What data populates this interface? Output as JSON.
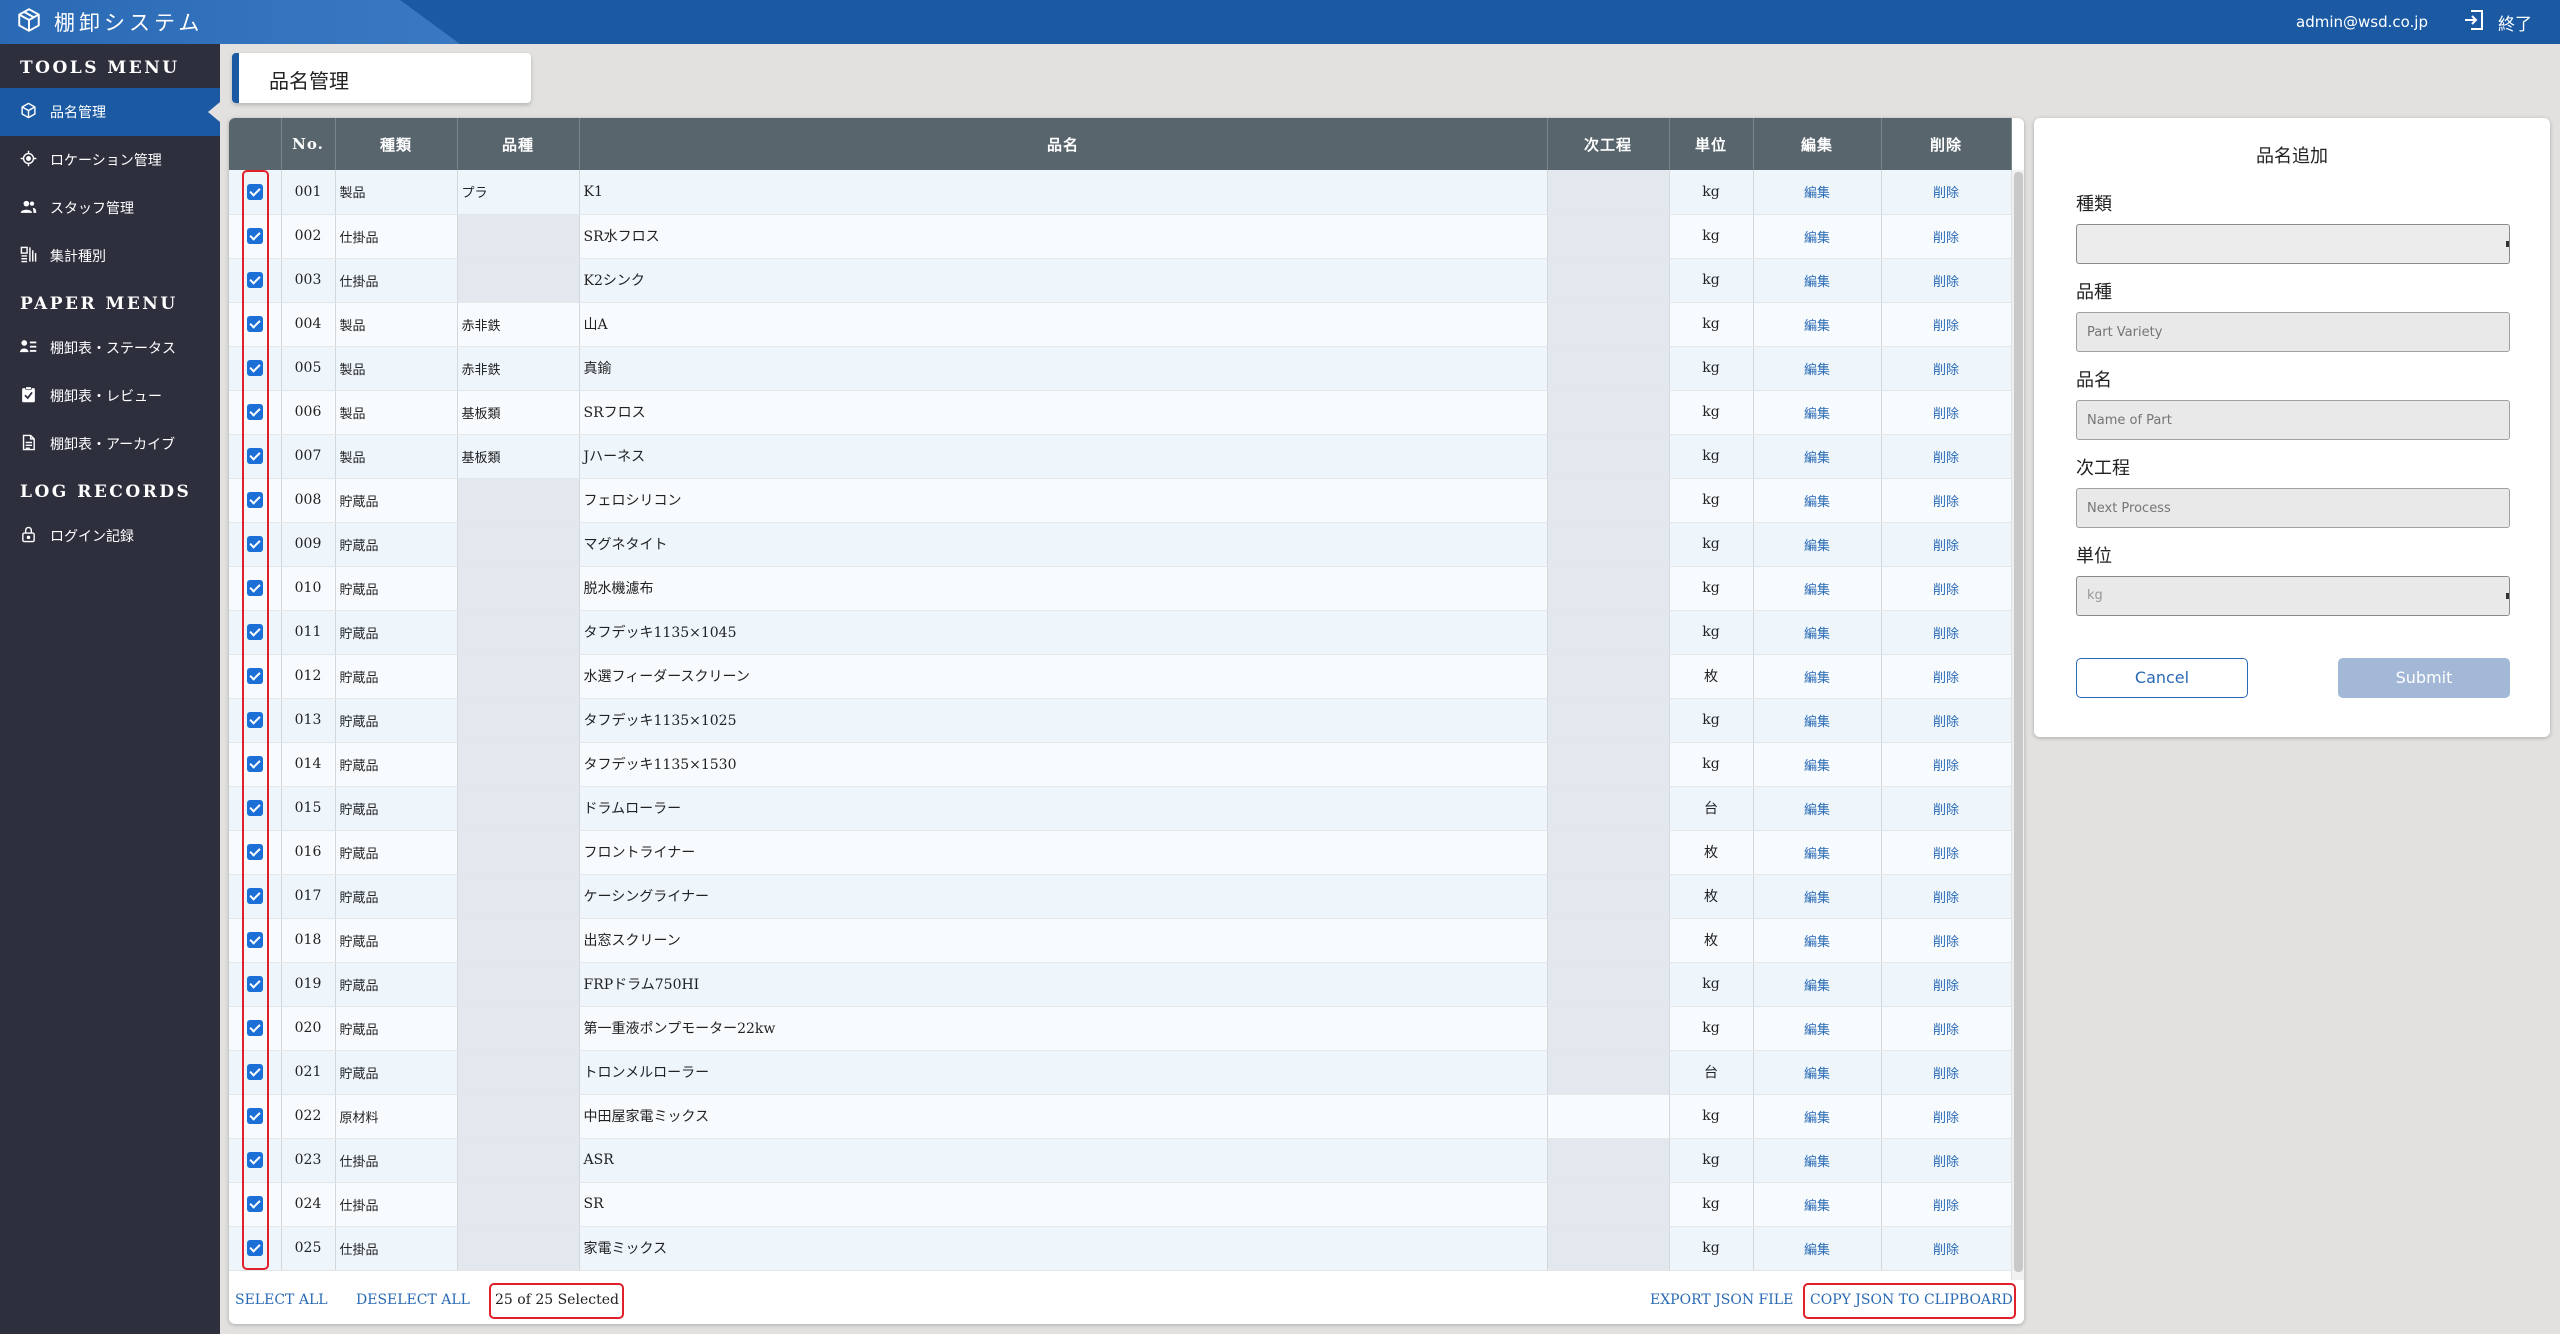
{
  "app": {
    "title": "棚卸システム",
    "user_email": "admin@wsd.co.jp",
    "logout_label": "終了"
  },
  "sidebar": {
    "sections": [
      {
        "title": "TOOLS MENU",
        "items": [
          {
            "label": "品名管理",
            "icon": "cube-icon",
            "active": true
          },
          {
            "label": "ロケーション管理",
            "icon": "location-icon"
          },
          {
            "label": "スタッフ管理",
            "icon": "staff-icon"
          },
          {
            "label": "集計種別",
            "icon": "aggregation-icon"
          }
        ]
      },
      {
        "title": "PAPER MENU",
        "items": [
          {
            "label": "棚卸表・ステータス",
            "icon": "status-list-icon"
          },
          {
            "label": "棚卸表・レビュー",
            "icon": "review-check-icon"
          },
          {
            "label": "棚卸表・アーカイブ",
            "icon": "archive-document-icon"
          }
        ]
      },
      {
        "title": "LOG RECORDS",
        "items": [
          {
            "label": "ログイン記録",
            "icon": "lock-icon"
          }
        ]
      }
    ]
  },
  "page": {
    "title": "品名管理"
  },
  "table": {
    "columns": [
      "",
      "No.",
      "種類",
      "品種",
      "品名",
      "次工程",
      "単位",
      "編集",
      "削除"
    ],
    "edit_label": "編集",
    "delete_label": "削除",
    "rows": [
      {
        "no": "001",
        "type": "製品",
        "variety": "プラ",
        "name": "K1",
        "next": "",
        "unit": "kg",
        "checked": true
      },
      {
        "no": "002",
        "type": "仕掛品",
        "variety": "",
        "name": "SR水フロス",
        "next": "",
        "unit": "kg",
        "checked": true
      },
      {
        "no": "003",
        "type": "仕掛品",
        "variety": "",
        "name": "K2シンク",
        "next": "",
        "unit": "kg",
        "checked": true
      },
      {
        "no": "004",
        "type": "製品",
        "variety": "赤非鉄",
        "name": "山A",
        "next": "",
        "unit": "kg",
        "checked": true
      },
      {
        "no": "005",
        "type": "製品",
        "variety": "赤非鉄",
        "name": "真鍮",
        "next": "",
        "unit": "kg",
        "checked": true
      },
      {
        "no": "006",
        "type": "製品",
        "variety": "基板類",
        "name": "SRフロス",
        "next": "",
        "unit": "kg",
        "checked": true
      },
      {
        "no": "007",
        "type": "製品",
        "variety": "基板類",
        "name": "Jハーネス",
        "next": "",
        "unit": "kg",
        "checked": true
      },
      {
        "no": "008",
        "type": "貯蔵品",
        "variety": "",
        "name": "フェロシリコン",
        "next": "",
        "unit": "kg",
        "checked": true
      },
      {
        "no": "009",
        "type": "貯蔵品",
        "variety": "",
        "name": "マグネタイト",
        "next": "",
        "unit": "kg",
        "checked": true
      },
      {
        "no": "010",
        "type": "貯蔵品",
        "variety": "",
        "name": "脱水機濾布",
        "next": "",
        "unit": "kg",
        "checked": true
      },
      {
        "no": "011",
        "type": "貯蔵品",
        "variety": "",
        "name": "タフデッキ1135×1045",
        "next": "",
        "unit": "kg",
        "checked": true
      },
      {
        "no": "012",
        "type": "貯蔵品",
        "variety": "",
        "name": "水選フィーダースクリーン",
        "next": "",
        "unit": "枚",
        "checked": true
      },
      {
        "no": "013",
        "type": "貯蔵品",
        "variety": "",
        "name": "タフデッキ1135×1025",
        "next": "",
        "unit": "kg",
        "checked": true
      },
      {
        "no": "014",
        "type": "貯蔵品",
        "variety": "",
        "name": "タフデッキ1135×1530",
        "next": "",
        "unit": "kg",
        "checked": true
      },
      {
        "no": "015",
        "type": "貯蔵品",
        "variety": "",
        "name": "ドラムローラー",
        "next": "",
        "unit": "台",
        "checked": true
      },
      {
        "no": "016",
        "type": "貯蔵品",
        "variety": "",
        "name": "フロントライナー",
        "next": "",
        "unit": "枚",
        "checked": true
      },
      {
        "no": "017",
        "type": "貯蔵品",
        "variety": "",
        "name": "ケーシングライナー",
        "next": "",
        "unit": "枚",
        "checked": true
      },
      {
        "no": "018",
        "type": "貯蔵品",
        "variety": "",
        "name": "出窓スクリーン",
        "next": "",
        "unit": "枚",
        "checked": true
      },
      {
        "no": "019",
        "type": "貯蔵品",
        "variety": "",
        "name": "FRPドラム750HI",
        "next": "",
        "unit": "kg",
        "checked": true
      },
      {
        "no": "020",
        "type": "貯蔵品",
        "variety": "",
        "name": "第一重液ポンプモーター22kw",
        "next": "",
        "unit": "kg",
        "checked": true
      },
      {
        "no": "021",
        "type": "貯蔵品",
        "variety": "",
        "name": "トロンメルローラー",
        "next": "",
        "unit": "台",
        "checked": true
      },
      {
        "no": "022",
        "type": "原材料",
        "variety": "",
        "name": "中田屋家電ミックス",
        "next": "",
        "unit": "kg",
        "checked": true
      },
      {
        "no": "023",
        "type": "仕掛品",
        "variety": "",
        "name": "ASR",
        "next": "",
        "unit": "kg",
        "checked": true
      },
      {
        "no": "024",
        "type": "仕掛品",
        "variety": "",
        "name": "SR",
        "next": "",
        "unit": "kg",
        "checked": true
      },
      {
        "no": "025",
        "type": "仕掛品",
        "variety": "",
        "name": "家電ミックス",
        "next": "",
        "unit": "kg",
        "checked": true
      }
    ]
  },
  "footer": {
    "select_all": "SELECT ALL",
    "deselect_all": "DESELECT ALL",
    "selection_count": "25 of 25 Selected",
    "export_json": "EXPORT JSON FILE",
    "copy_json": "COPY JSON TO CLIPBOARD"
  },
  "form": {
    "title": "品名追加",
    "type_label": "種類",
    "type_value": "",
    "variety_label": "品種",
    "variety_placeholder": "Part Variety",
    "name_label": "品名",
    "name_placeholder": "Name of Part",
    "next_label": "次工程",
    "next_placeholder": "Next Process",
    "unit_label": "単位",
    "unit_value": "kg",
    "cancel_label": "Cancel",
    "submit_label": "Submit"
  },
  "colors": {
    "header": "#1b5aa3",
    "sidebar": "#2d2f3d",
    "link": "#2a6ab5",
    "highlight": "#e0202a"
  }
}
